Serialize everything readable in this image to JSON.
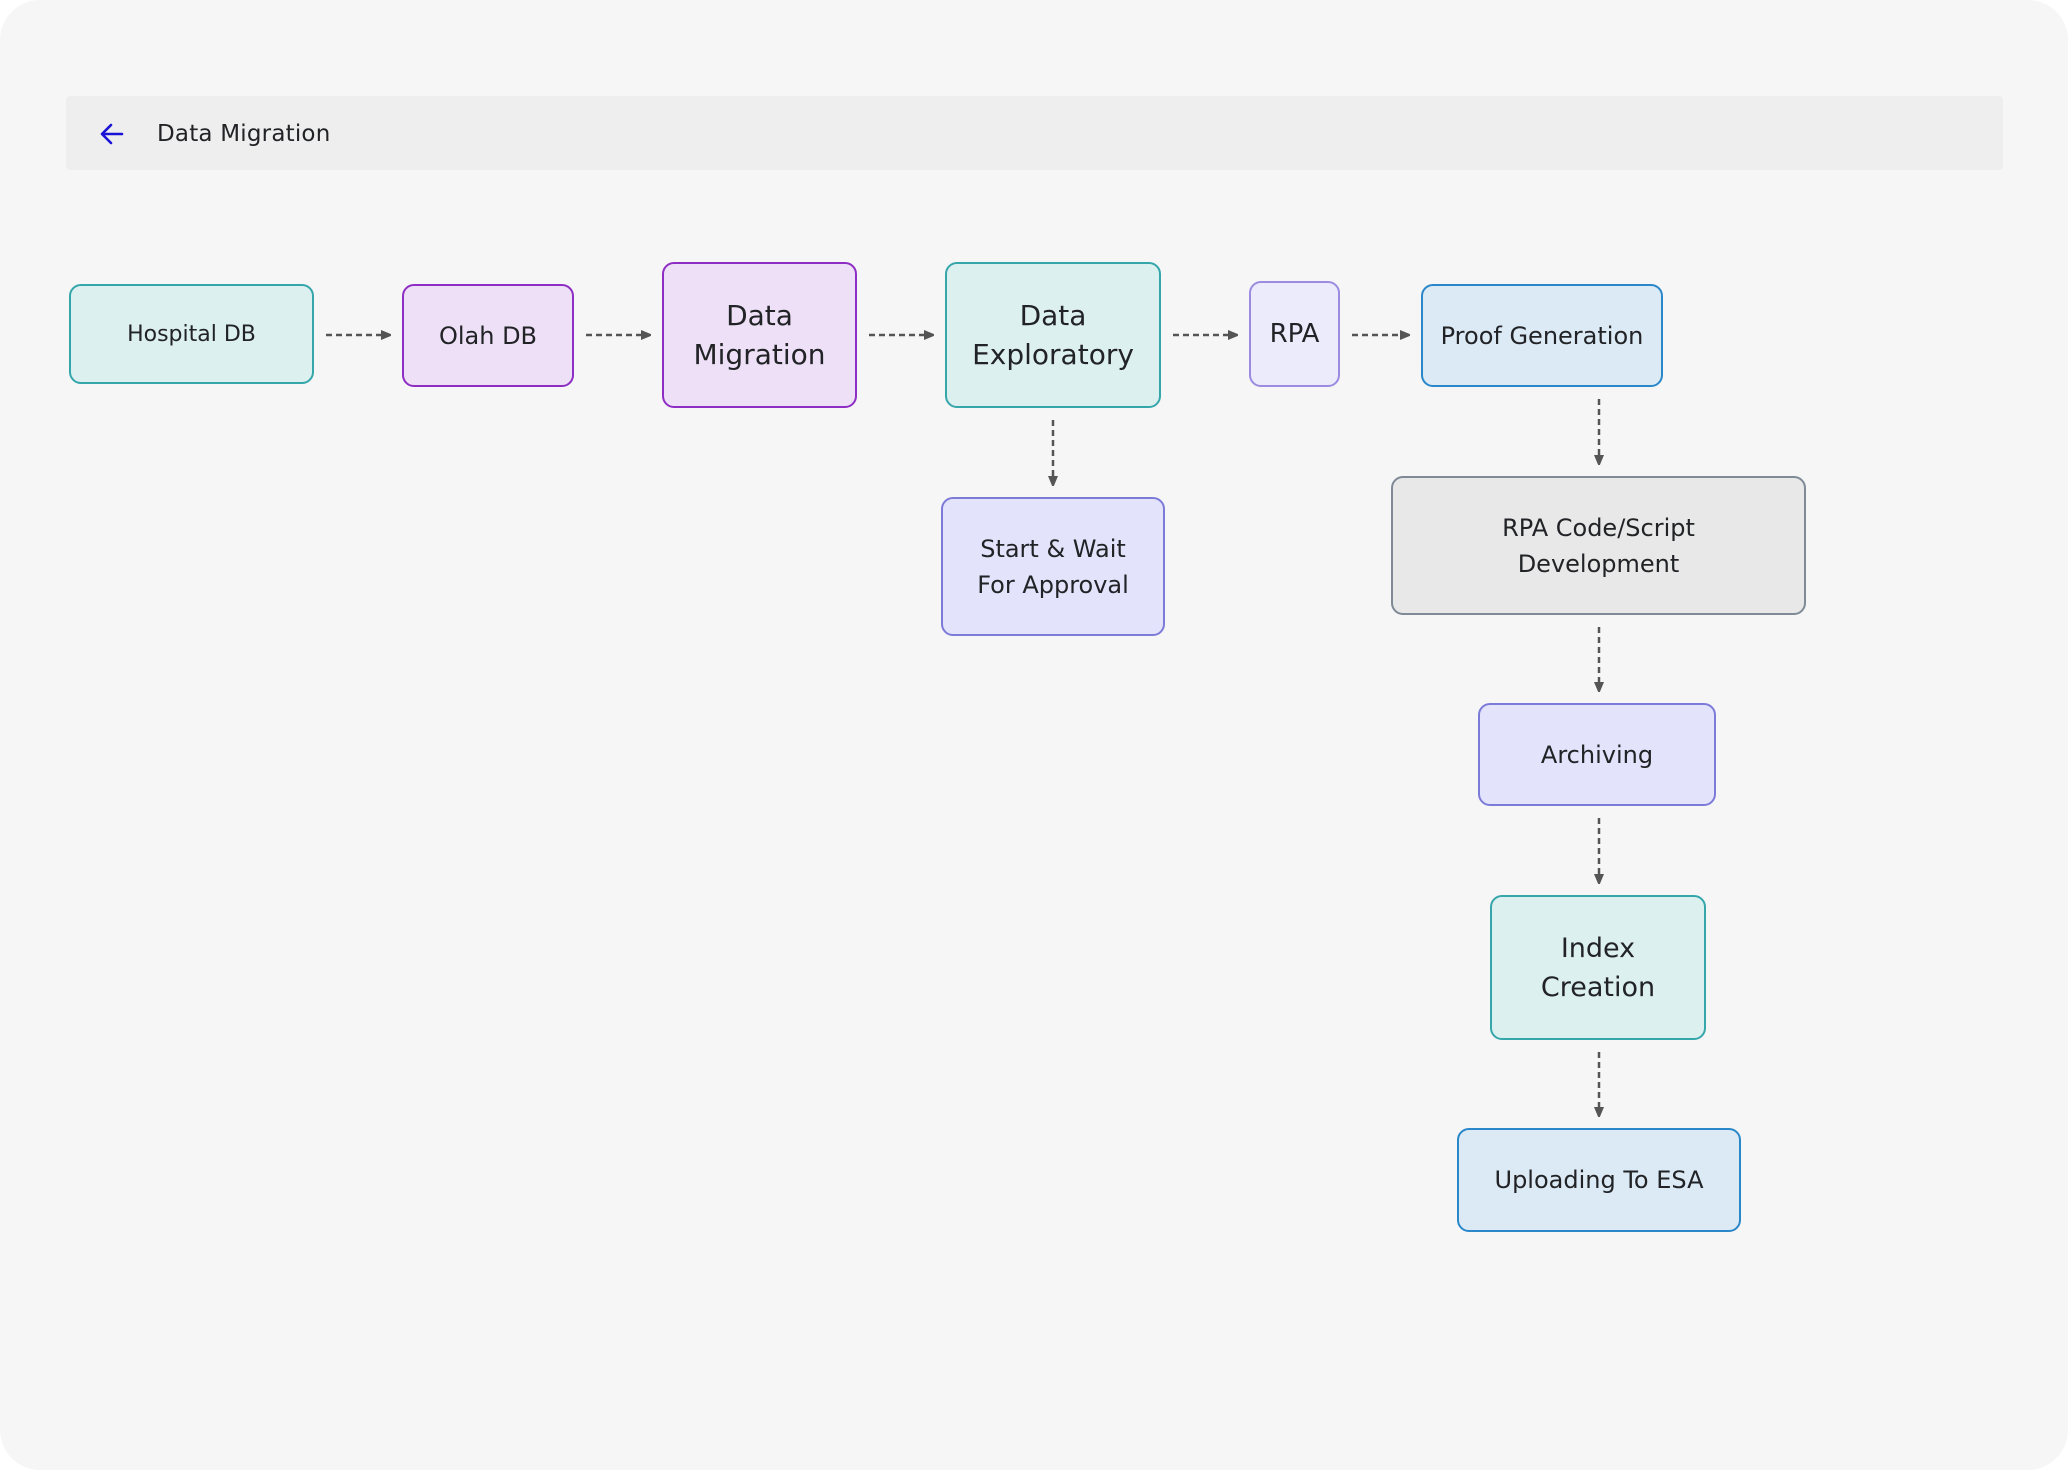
{
  "header": {
    "title": "Data Migration",
    "back_icon": "arrow-left-icon",
    "accent_color": "#1a12d6"
  },
  "diagram": {
    "nodes": [
      {
        "id": "hospital-db",
        "label": "Hospital DB",
        "style": "teal"
      },
      {
        "id": "olah-db",
        "label": "Olah DB",
        "style": "purple"
      },
      {
        "id": "data-migration",
        "label": "Data Migration",
        "lines": [
          "Data",
          "Migration"
        ],
        "style": "purple"
      },
      {
        "id": "data-exploratory",
        "label": "Data Exploratory",
        "lines": [
          "Data",
          "Exploratory"
        ],
        "style": "teal"
      },
      {
        "id": "rpa",
        "label": "RPA",
        "style": "lavender-light"
      },
      {
        "id": "proof-generation",
        "label": "Proof Generation",
        "style": "blue"
      },
      {
        "id": "start-wait-approval",
        "label": "Start & Wait For Approval",
        "lines": [
          "Start & Wait",
          "For Approval"
        ],
        "style": "lavender"
      },
      {
        "id": "rpa-code-script",
        "label": "RPA Code/Script Development",
        "lines": [
          "RPA Code/Script",
          "Development"
        ],
        "style": "grey"
      },
      {
        "id": "archiving",
        "label": "Archiving",
        "style": "lavender"
      },
      {
        "id": "index-creation",
        "label": "Index Creation",
        "lines": [
          "Index",
          "Creation"
        ],
        "style": "teal"
      },
      {
        "id": "uploading-esa",
        "label": "Uploading To ESA",
        "style": "blue"
      }
    ],
    "edges": [
      {
        "from": "hospital-db",
        "to": "olah-db",
        "style": "dashed"
      },
      {
        "from": "olah-db",
        "to": "data-migration",
        "style": "dashed"
      },
      {
        "from": "data-migration",
        "to": "data-exploratory",
        "style": "dashed"
      },
      {
        "from": "data-exploratory",
        "to": "rpa",
        "style": "dashed"
      },
      {
        "from": "rpa",
        "to": "proof-generation",
        "style": "dashed"
      },
      {
        "from": "data-exploratory",
        "to": "start-wait-approval",
        "style": "dashed"
      },
      {
        "from": "proof-generation",
        "to": "rpa-code-script",
        "style": "dashed"
      },
      {
        "from": "rpa-code-script",
        "to": "archiving",
        "style": "dashed"
      },
      {
        "from": "archiving",
        "to": "index-creation",
        "style": "dashed"
      },
      {
        "from": "index-creation",
        "to": "uploading-esa",
        "style": "dashed"
      }
    ],
    "edge_color": "#555555"
  }
}
